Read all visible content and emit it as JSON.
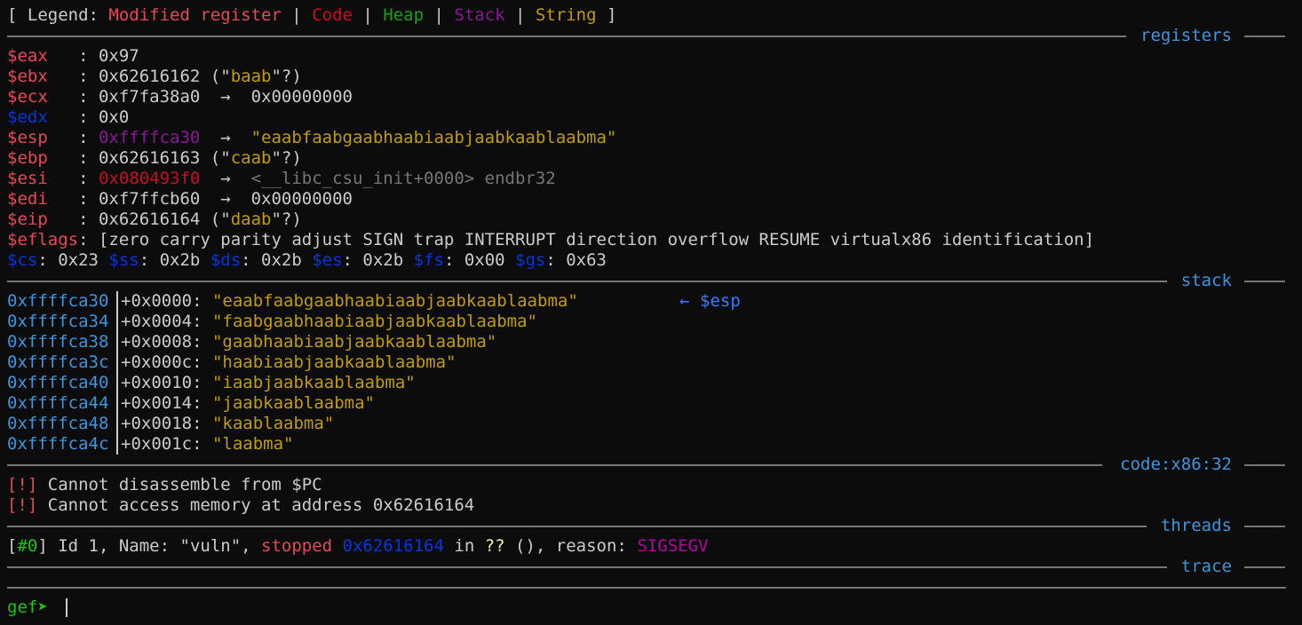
{
  "legend": {
    "open": "[ Legend: ",
    "modified": "Modified register",
    "code": "Code",
    "heap": "Heap",
    "stack": "Stack",
    "string": "String",
    "pipe": " | ",
    "close": " ]"
  },
  "sections": {
    "registers": "registers",
    "stack": "stack",
    "code": "code:x86:32",
    "threads": "threads",
    "trace": "trace"
  },
  "registers": {
    "eax": {
      "name": "$eax",
      "sep": "   : ",
      "value": "0x97"
    },
    "ebx": {
      "name": "$ebx",
      "sep": "   : ",
      "value": "0x62616162",
      "pre": " (\"",
      "str": "baab",
      "post": "\"?)"
    },
    "ecx": {
      "name": "$ecx",
      "sep": "   : ",
      "value": "0xf7fa38a0",
      "arrow": "  →  ",
      "deref": "0x00000000"
    },
    "edx": {
      "name": "$edx",
      "sep": "   : ",
      "value": "0x0"
    },
    "esp": {
      "name": "$esp",
      "sep": "   : ",
      "value": "0xffffca30",
      "arrow": "  →  ",
      "deref": "\"eaabfaabgaabhaabiaabjaabkaablaabma\""
    },
    "ebp": {
      "name": "$ebp",
      "sep": "   : ",
      "value": "0x62616163",
      "pre": " (\"",
      "str": "caab",
      "post": "\"?)"
    },
    "esi": {
      "name": "$esi",
      "sep": "   : ",
      "value": "0x080493f0",
      "arrow": "  →  ",
      "deref": "<__libc_csu_init+0000> endbr32"
    },
    "edi": {
      "name": "$edi",
      "sep": "   : ",
      "value": "0xf7ffcb60",
      "arrow": "  →  ",
      "deref": "0x00000000"
    },
    "eip": {
      "name": "$eip",
      "sep": "   : ",
      "value": "0x62616164",
      "pre": " (\"",
      "str": "daab",
      "post": "\"?)"
    },
    "eflags": {
      "name": "$eflags",
      "sep": ": ",
      "open": "[",
      "lower1": "zero carry parity adjust ",
      "sign": "SIGN",
      "lower2": " trap ",
      "interrupt": "INTERRUPT",
      "lower3": " direction overflow ",
      "resume": "RESUME",
      "lower4": " virtualx86 identification",
      "close": "]"
    },
    "segments": {
      "cs_name": "$cs",
      "cs_val": ": 0x23 ",
      "ss_name": "$ss",
      "ss_val": ": 0x2b ",
      "ds_name": "$ds",
      "ds_val": ": 0x2b ",
      "es_name": "$es",
      "es_val": ": 0x2b ",
      "fs_name": "$fs",
      "fs_val": ": 0x00 ",
      "gs_name": "$gs",
      "gs_val": ": 0x63"
    }
  },
  "stack": [
    {
      "addr": "0xffffca30",
      "offset": "+0x0000: ",
      "value": "\"eaabfaabgaabhaabiaabjaabkaablaabma\"",
      "marker": "          ← $esp"
    },
    {
      "addr": "0xffffca34",
      "offset": "+0x0004: ",
      "value": "\"faabgaabhaabiaabjaabkaablaabma\"",
      "marker": ""
    },
    {
      "addr": "0xffffca38",
      "offset": "+0x0008: ",
      "value": "\"gaabhaabiaabjaabkaablaabma\"",
      "marker": ""
    },
    {
      "addr": "0xffffca3c",
      "offset": "+0x000c: ",
      "value": "\"haabiaabjaabkaablaabma\"",
      "marker": ""
    },
    {
      "addr": "0xffffca40",
      "offset": "+0x0010: ",
      "value": "\"iaabjaabkaablaabma\"",
      "marker": ""
    },
    {
      "addr": "0xffffca44",
      "offset": "+0x0014: ",
      "value": "\"jaabkaablaabma\"",
      "marker": ""
    },
    {
      "addr": "0xffffca48",
      "offset": "+0x0018: ",
      "value": "\"kaablaabma\"",
      "marker": ""
    },
    {
      "addr": "0xffffca4c",
      "offset": "+0x001c: ",
      "value": "\"laabma\"",
      "marker": ""
    }
  ],
  "code": {
    "tag": "[!]",
    "msg1": " Cannot disassemble from $PC",
    "msg2": " Cannot access memory at address 0x62616164"
  },
  "threads": {
    "open": "[",
    "id": "#0",
    "close": "]",
    "t1": " Id 1, Name: \"vuln\", ",
    "stopped": "stopped",
    "space": " ",
    "addr": "0x62616164",
    "in": " in ",
    "func": "??",
    "t2": " (), reason: ",
    "reason": "SIGSEGV"
  },
  "prompt": {
    "text": "gef➤"
  }
}
